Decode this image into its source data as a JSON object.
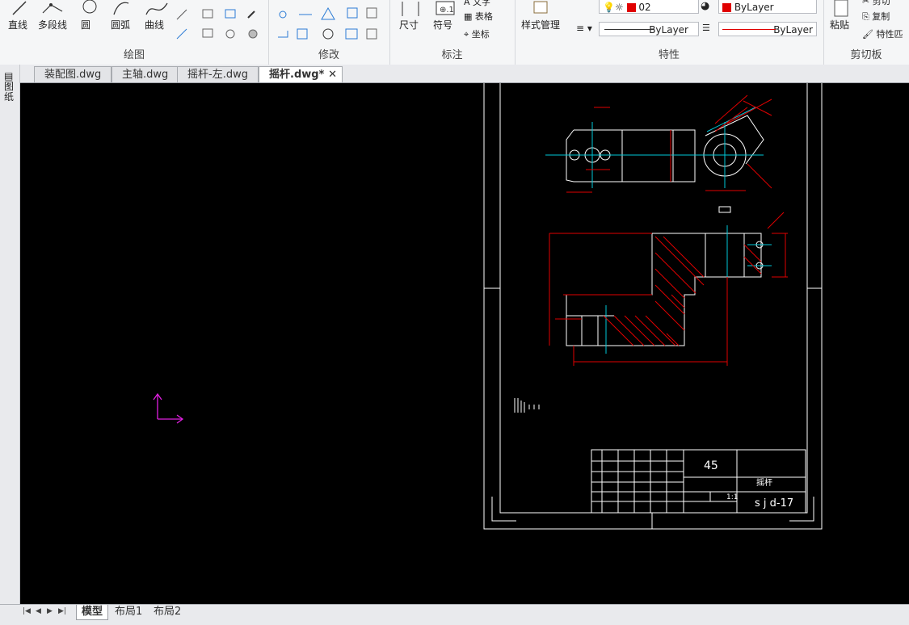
{
  "ribbon": {
    "draw": {
      "label": "绘图",
      "line": "直线",
      "polyline": "多段线",
      "circle": "圆",
      "arc": "圆弧",
      "curve": "曲线"
    },
    "modify": {
      "label": "修改"
    },
    "annotate": {
      "label": "标注",
      "dimension": "尺寸",
      "symbol": "符号",
      "text": "文字",
      "table": "表格",
      "coordinate": "坐标"
    },
    "properties": {
      "label": "特性",
      "style_manager": "样式管理",
      "layer_value": "02",
      "color_value": "ByLayer",
      "linetype_value": "ByLayer",
      "lineweight_value": "ByLayer"
    },
    "clipboard": {
      "label": "剪切板",
      "paste": "粘贴",
      "cut": "剪切",
      "copy": "复制",
      "match_props": "特性匹"
    }
  },
  "left_toolbar": {
    "label": "图纸"
  },
  "tabs": [
    {
      "label": "装配图.dwg"
    },
    {
      "label": "主轴.dwg"
    },
    {
      "label": "摇杆-左.dwg"
    },
    {
      "label": "摇杆.dwg*"
    }
  ],
  "drawing": {
    "title_block": {
      "material": "45",
      "part_name": "摇杆",
      "drawing_no": "s j d-17",
      "scale": "1:1"
    }
  },
  "layout_tabs": [
    {
      "label": "模型"
    },
    {
      "label": "布局1"
    },
    {
      "label": "布局2"
    }
  ],
  "colors": {
    "accent_red": "#e00000",
    "cyan": "#00c8d8",
    "magenta": "#e020e0",
    "canvas_bg": "#000000"
  }
}
